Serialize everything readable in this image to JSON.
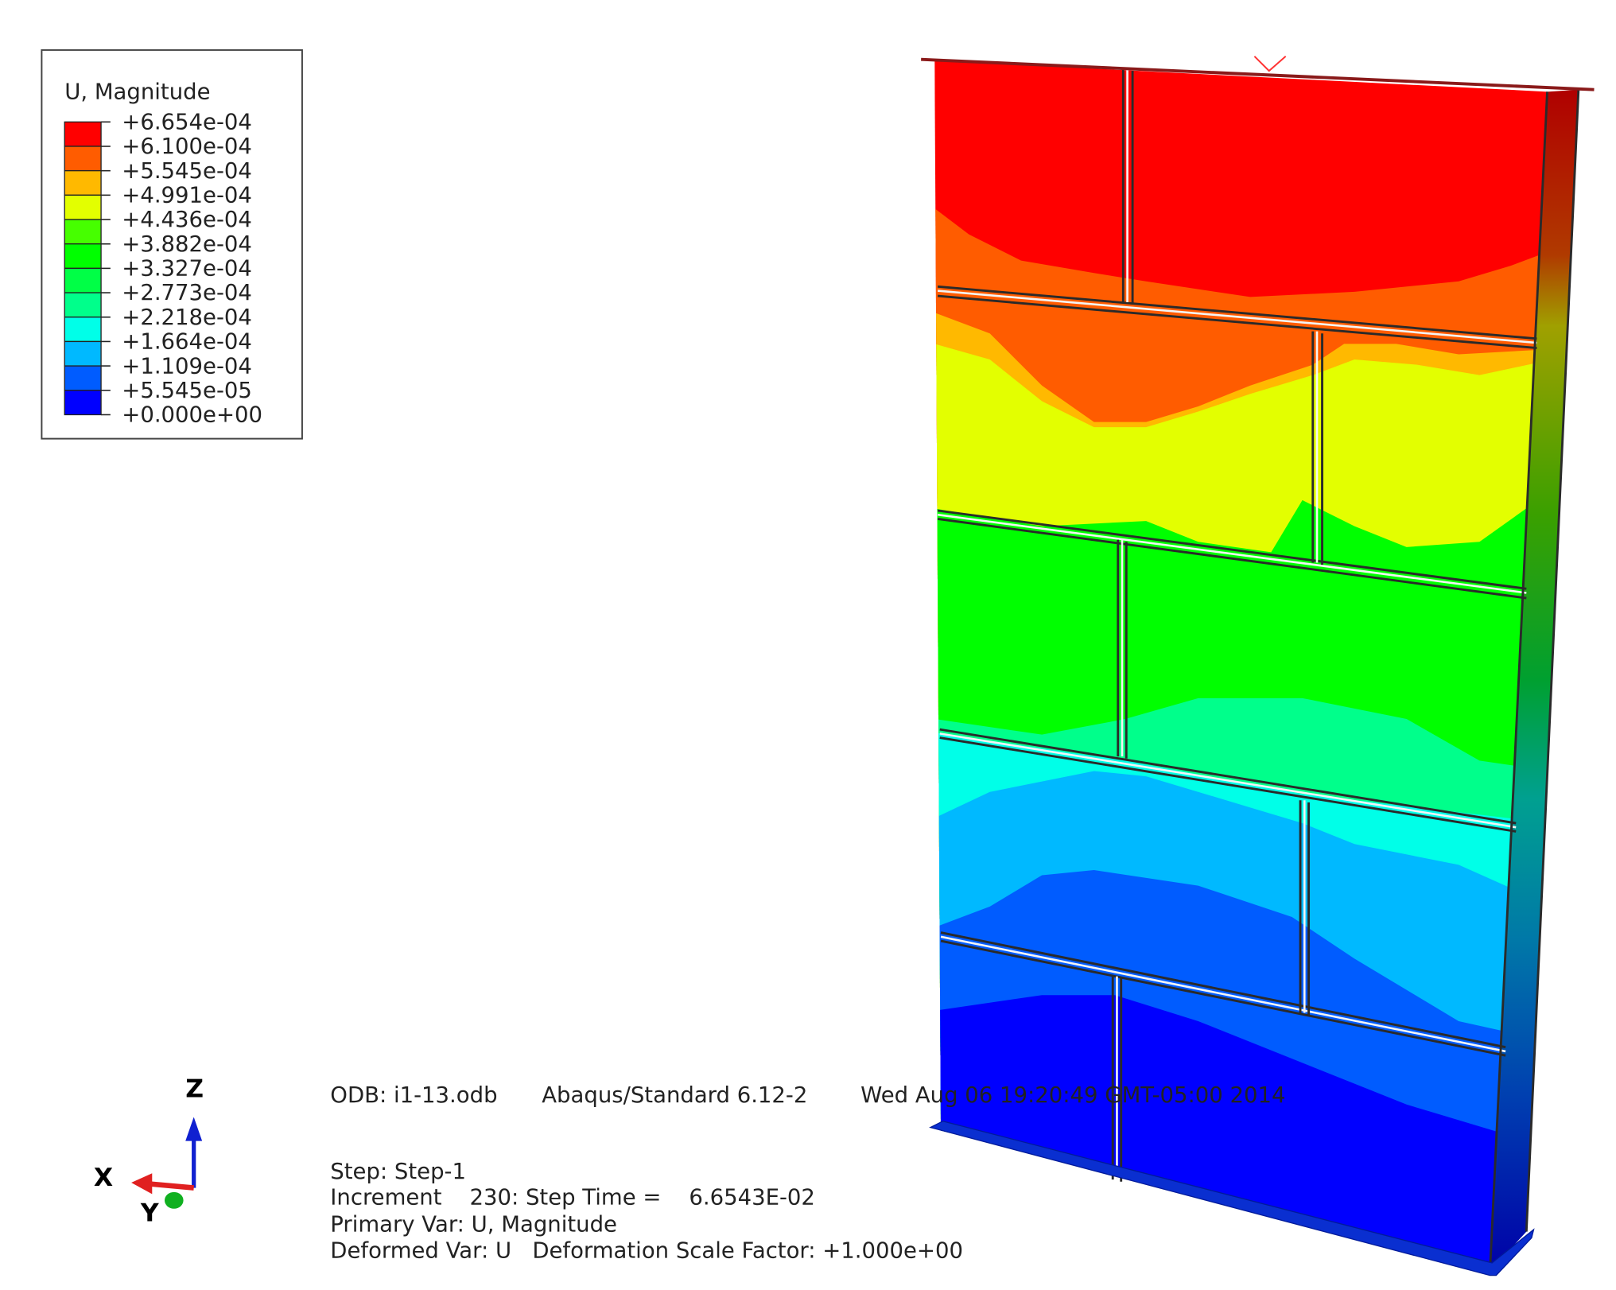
{
  "legend": {
    "title": "U, Magnitude",
    "labels": [
      "+6.654e-04",
      "+6.100e-04",
      "+5.545e-04",
      "+4.991e-04",
      "+4.436e-04",
      "+3.882e-04",
      "+3.327e-04",
      "+2.773e-04",
      "+2.218e-04",
      "+1.664e-04",
      "+1.109e-04",
      "+5.545e-05",
      "+0.000e+00"
    ],
    "colors": [
      "#ff0000",
      "#ff5c00",
      "#ffb900",
      "#e3ff00",
      "#46ff00",
      "#00ff00",
      "#00ff46",
      "#00ff8b",
      "#00ffe8",
      "#00b9ff",
      "#005cff",
      "#0000ff"
    ]
  },
  "triad": {
    "z": "Z",
    "x": "X",
    "y": "Y"
  },
  "info": {
    "odb": "ODB: i1-13.odb",
    "solver": "Abaqus/Standard 6.12-2",
    "date": "Wed Aug 06 19:20:49 GMT-05:00 2014",
    "step": "Step: Step-1",
    "increment": "Increment    230: Step Time =    6.6543E-02",
    "primary_var": "Primary Var: U, Magnitude",
    "deformed_var": "Deformed Var: U   Deformation Scale Factor: +1.000e+00"
  }
}
